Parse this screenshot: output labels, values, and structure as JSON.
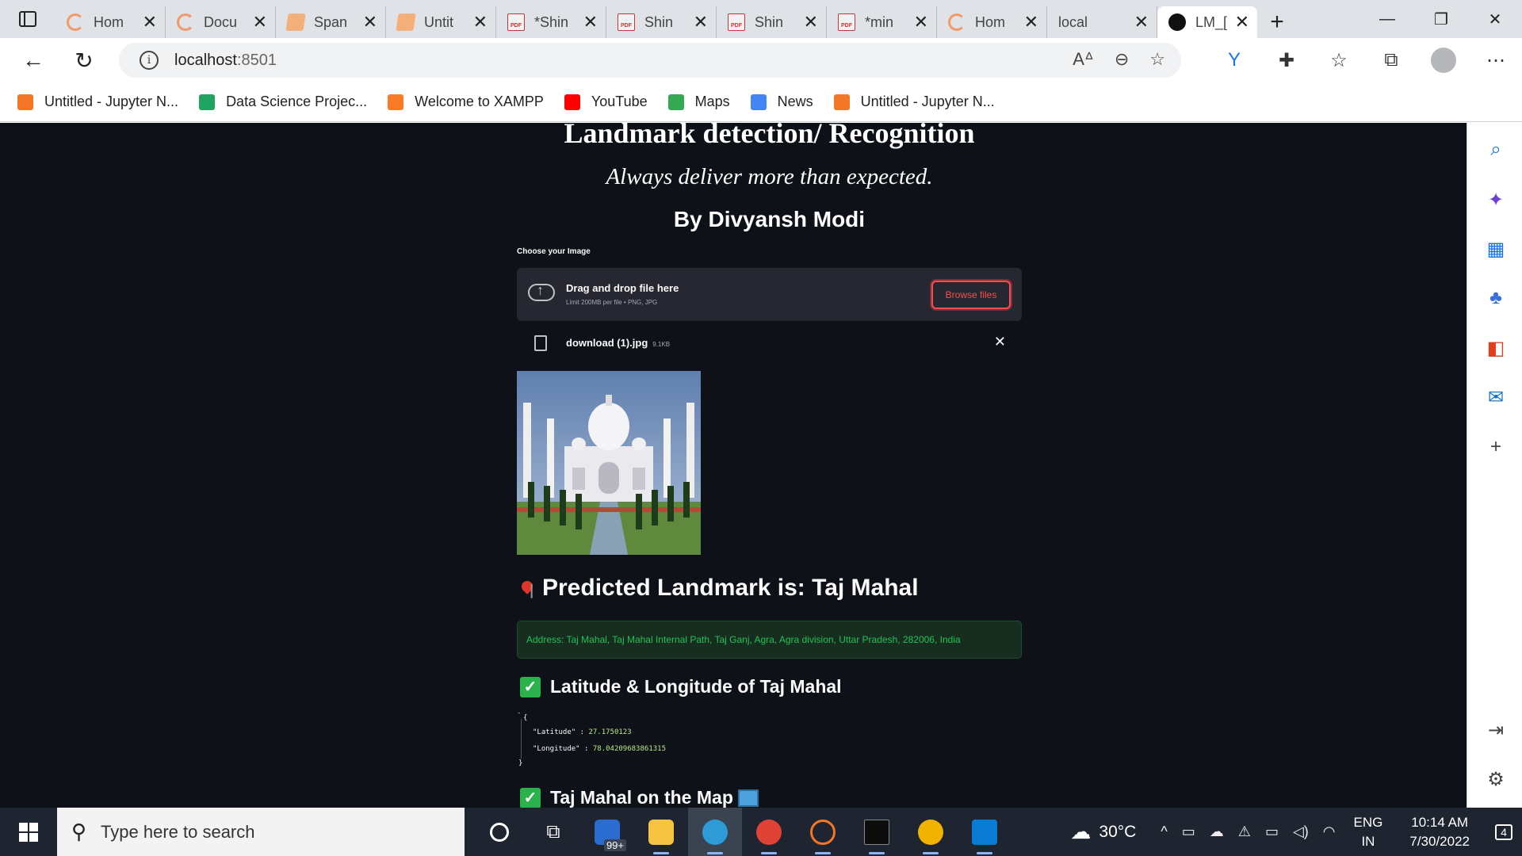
{
  "browser": {
    "tabs": [
      {
        "title": "Hom",
        "icon": "spinner-icon"
      },
      {
        "title": "Docu",
        "icon": "spinner-icon"
      },
      {
        "title": "Span",
        "icon": "jupyter-icon"
      },
      {
        "title": "Untit",
        "icon": "jupyter-icon"
      },
      {
        "title": "*Shin",
        "icon": "pdf-icon"
      },
      {
        "title": "Shin",
        "icon": "pdf-icon"
      },
      {
        "title": "Shin",
        "icon": "pdf-icon"
      },
      {
        "title": "*min",
        "icon": "pdf-icon"
      },
      {
        "title": "Hom",
        "icon": "spinner-icon"
      },
      {
        "title": "local",
        "icon": "page-icon"
      },
      {
        "title": "LM_[",
        "icon": "streamlit-icon",
        "active": true
      }
    ],
    "address": {
      "host": "localhost",
      "port": ":8501"
    },
    "bookmarks": [
      {
        "label": "Untitled - Jupyter N...",
        "color": "#f37726"
      },
      {
        "label": "Data Science Projec...",
        "color": "#1fa463"
      },
      {
        "label": "Welcome to XAMPP",
        "color": "#fb7a24"
      },
      {
        "label": "YouTube",
        "color": "#ff0000"
      },
      {
        "label": "Maps",
        "color": "#34a853"
      },
      {
        "label": "News",
        "color": "#4285f4"
      },
      {
        "label": "Untitled - Jupyter N...",
        "color": "#f37726"
      }
    ]
  },
  "app": {
    "title": "Landmark detection/ Recognition",
    "subtitle": "Always deliver more than expected.",
    "author": "By  Divyansh Modi",
    "uploader": {
      "label": "Choose your Image",
      "drag_text": "Drag and drop file here",
      "limit_text": "Limit 200MB per file • PNG, JPG",
      "browse_label": "Browse files",
      "file_name": "download (1).jpg",
      "file_size": "9.1KB"
    },
    "prediction": "Predicted Landmark is: Taj Mahal",
    "address": "Address: Taj Mahal, Taj Mahal Internal Path, Taj Ganj, Agra, Agra division, Uttar Pradesh, 282006, India",
    "coords_heading": "Latitude & Longitude of Taj Mahal",
    "coords": {
      "open": "{",
      "lat_key": "\"Latitude\" :",
      "lat_val": "27.1750123",
      "lon_key": "\"Longitude\" :",
      "lon_val": "78.04209683861315",
      "close": "}"
    },
    "map_heading": "Taj Mahal on the Map"
  },
  "taskbar": {
    "search_placeholder": "Type here to search",
    "mail_badge": "99+",
    "temperature": "30°C",
    "lang_line1": "ENG",
    "lang_line2": "IN",
    "time": "10:14 AM",
    "date": "7/30/2022",
    "notifications": "4"
  }
}
